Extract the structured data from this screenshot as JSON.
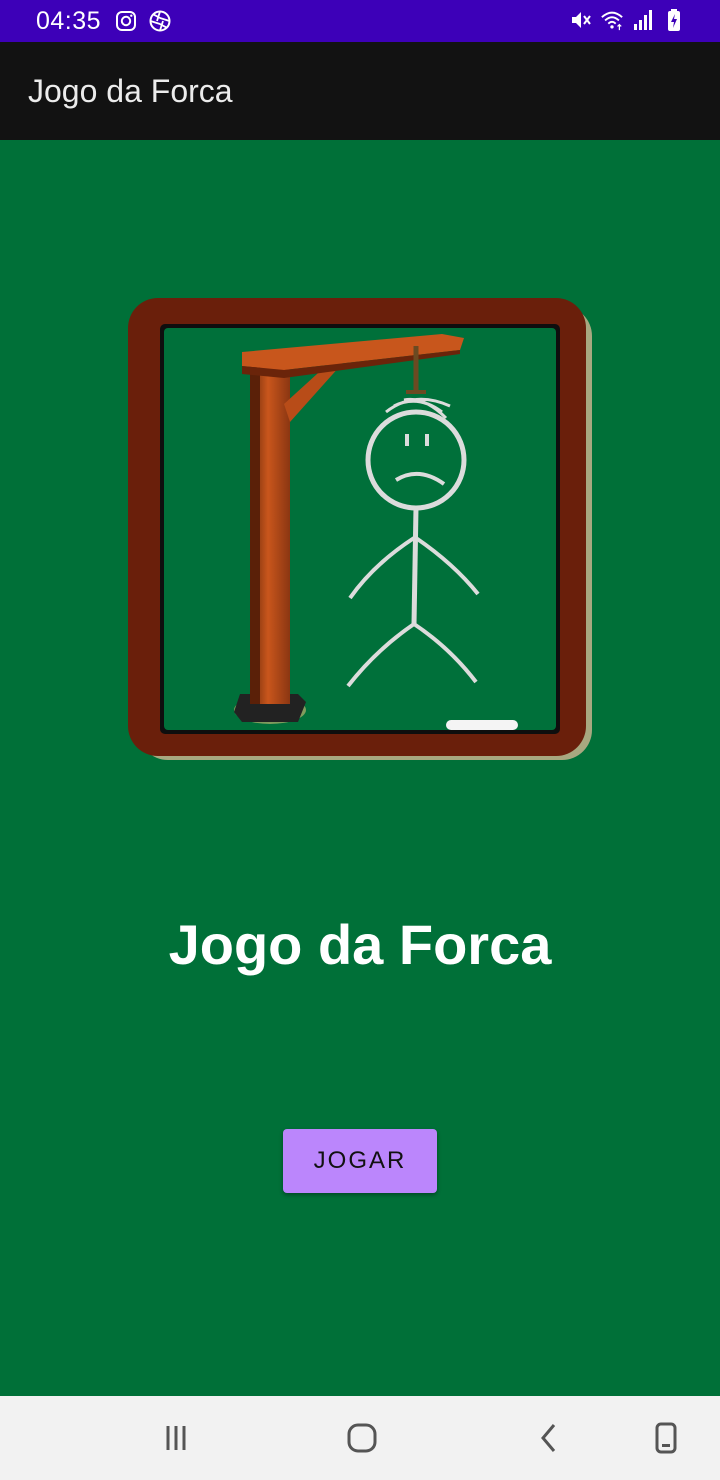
{
  "status_bar": {
    "time": "04:35",
    "left_icons": [
      "instagram-icon",
      "aperture-icon"
    ],
    "right_icons": [
      "mute-icon",
      "wifi-icon",
      "signal-icon",
      "battery-charging-icon"
    ],
    "color": "#3d00b8"
  },
  "app_bar": {
    "title": "Jogo da Forca",
    "color": "#121212"
  },
  "main": {
    "logo_icon": "hangman-gallows-icon",
    "title": "Jogo da Forca",
    "play_button_label": "JOGAR",
    "background_color": "#007038",
    "button_color": "#bb86fc"
  },
  "nav_bar": {
    "buttons": [
      "recent-apps-icon",
      "home-icon",
      "back-icon",
      "rotate-screen-icon"
    ]
  }
}
